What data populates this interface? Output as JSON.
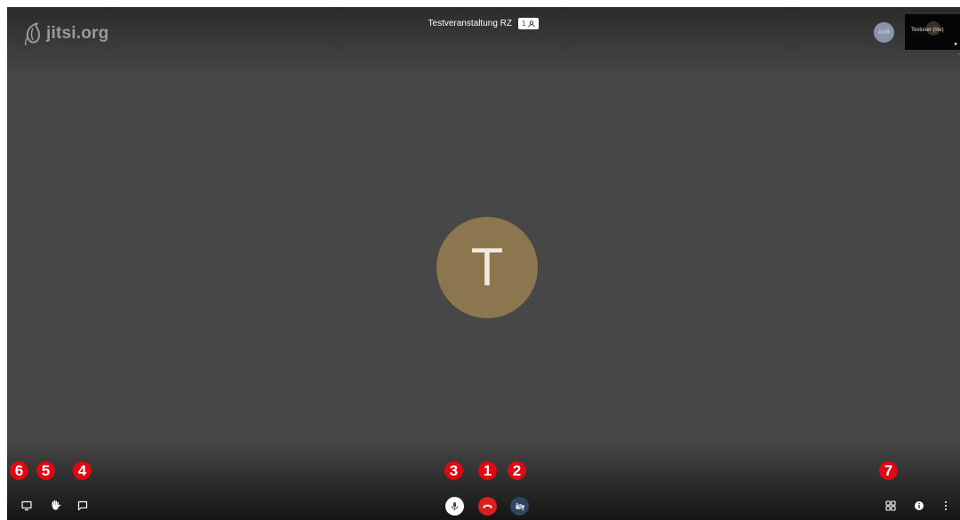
{
  "brand": {
    "logo_text": "jitsi.org"
  },
  "header": {
    "meeting_title": "Testveranstaltung RZ",
    "participant_count": "1"
  },
  "participants": {
    "local_avatar_initials": "AGR",
    "thumbnail_name": "Testuser (me)",
    "large_avatar_initial": "T"
  },
  "toolbar": {
    "left": [
      "monitor-icon",
      "raise-hand-icon",
      "chat-icon"
    ],
    "center": [
      "microphone-icon",
      "hangup-icon",
      "camera-off-icon"
    ],
    "right": [
      "tile-view-icon",
      "info-icon",
      "more-vertical-icon"
    ]
  },
  "annotations": {
    "marker_1": "1",
    "marker_2": "2",
    "marker_3": "3",
    "marker_4": "4",
    "marker_5": "5",
    "marker_6": "6",
    "marker_7": "7"
  },
  "colors": {
    "stage": "#474747",
    "hangup": "#d61f1f",
    "annotation_red": "#e20613",
    "avatar": "#8c7650"
  }
}
